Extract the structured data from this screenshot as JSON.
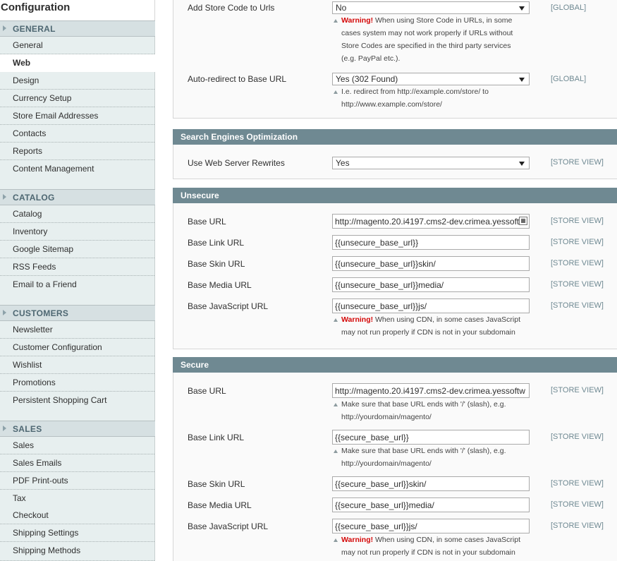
{
  "sidebar": {
    "title": "Configuration",
    "groups": [
      {
        "label": "GENERAL",
        "items": [
          "General",
          "Web",
          "Design",
          "Currency Setup",
          "Store Email Addresses",
          "Contacts",
          "Reports",
          "Content Management"
        ]
      },
      {
        "label": "CATALOG",
        "items": [
          "Catalog",
          "Inventory",
          "Google Sitemap",
          "RSS Feeds",
          "Email to a Friend"
        ]
      },
      {
        "label": "CUSTOMERS",
        "items": [
          "Newsletter",
          "Customer Configuration",
          "Wishlist",
          "Promotions",
          "Persistent Shopping Cart"
        ]
      },
      {
        "label": "SALES",
        "items": [
          "Sales",
          "Sales Emails",
          "PDF Print-outs",
          "Tax",
          "Checkout",
          "Shipping Settings",
          "Shipping Methods"
        ]
      }
    ],
    "active_item": "Web"
  },
  "url_options": {
    "add_store_code": {
      "label": "Add Store Code to Urls",
      "value": "No",
      "scope": "[GLOBAL]",
      "warning_label": "Warning!",
      "note": [
        " When using Store Code in URLs, in some",
        "cases system may not work properly if URLs without",
        "Store Codes are specified in the third party services",
        "(e.g. PayPal etc.)."
      ]
    },
    "auto_redirect": {
      "label": "Auto-redirect to Base URL",
      "value": "Yes (302 Found)",
      "scope": "[GLOBAL]",
      "note": [
        "I.e. redirect from http://example.com/store/ to",
        "http://www.example.com/store/"
      ]
    }
  },
  "seo": {
    "title": "Search Engines Optimization",
    "rewrites": {
      "label": "Use Web Server Rewrites",
      "value": "Yes",
      "scope": "[STORE VIEW]"
    }
  },
  "unsecure": {
    "title": "Unsecure",
    "rows": [
      {
        "label": "Base URL",
        "value": "http://magento.20.i4197.cms2-dev.crimea.yessoftw",
        "scope": "[STORE VIEW]",
        "icon": "table-icon"
      },
      {
        "label": "Base Link URL",
        "value": "{{unsecure_base_url}}",
        "scope": "[STORE VIEW]"
      },
      {
        "label": "Base Skin URL",
        "value": "{{unsecure_base_url}}skin/",
        "scope": "[STORE VIEW]"
      },
      {
        "label": "Base Media URL",
        "value": "{{unsecure_base_url}}media/",
        "scope": "[STORE VIEW]"
      },
      {
        "label": "Base JavaScript URL",
        "value": "{{unsecure_base_url}}js/",
        "scope": "[STORE VIEW]"
      }
    ],
    "js_warning_label": "Warning!",
    "js_note": [
      " When using CDN, in some cases JavaScript",
      "may not run properly if CDN is not in your subdomain"
    ]
  },
  "secure": {
    "title": "Secure",
    "rows": [
      {
        "label": "Base URL",
        "value": "http://magento.20.i4197.cms2-dev.crimea.yessoftw",
        "scope": "[STORE VIEW]"
      },
      {
        "label": "Base Link URL",
        "value": "{{secure_base_url}}",
        "scope": "[STORE VIEW]"
      },
      {
        "label": "Base Skin URL",
        "value": "{{secure_base_url}}skin/",
        "scope": "[STORE VIEW]"
      },
      {
        "label": "Base Media URL",
        "value": "{{secure_base_url}}media/",
        "scope": "[STORE VIEW]"
      },
      {
        "label": "Base JavaScript URL",
        "value": "{{secure_base_url}}js/",
        "scope": "[STORE VIEW]"
      }
    ],
    "base_url_note": [
      "Make sure that base URL ends with '/' (slash), e.g.",
      "http://yourdomain/magento/"
    ],
    "link_url_note": [
      "Make sure that base URL ends with '/' (slash), e.g.",
      "http://yourdomain/magento/"
    ],
    "js_warning_label": "Warning!",
    "js_note": [
      " When using CDN, in some cases JavaScript",
      "may not run properly if CDN is not in your subdomain"
    ]
  },
  "colors": {
    "section_header": "#6f8992",
    "sidebar_group": "#d6e0e2",
    "scope_text": "#6f8992",
    "warning": "#d40707"
  }
}
